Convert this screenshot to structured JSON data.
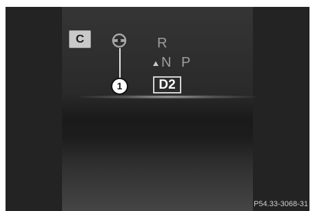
{
  "drive_display": {
    "mode_badge": "C",
    "callout_number": "1",
    "gears": {
      "reverse": "R",
      "neutral": "N",
      "park": "P",
      "active": "D2"
    },
    "icons": {
      "steering": "steering-wheel-icon",
      "direction": "up-arrow-icon"
    },
    "reference_code": "P54.33-3068-31"
  }
}
